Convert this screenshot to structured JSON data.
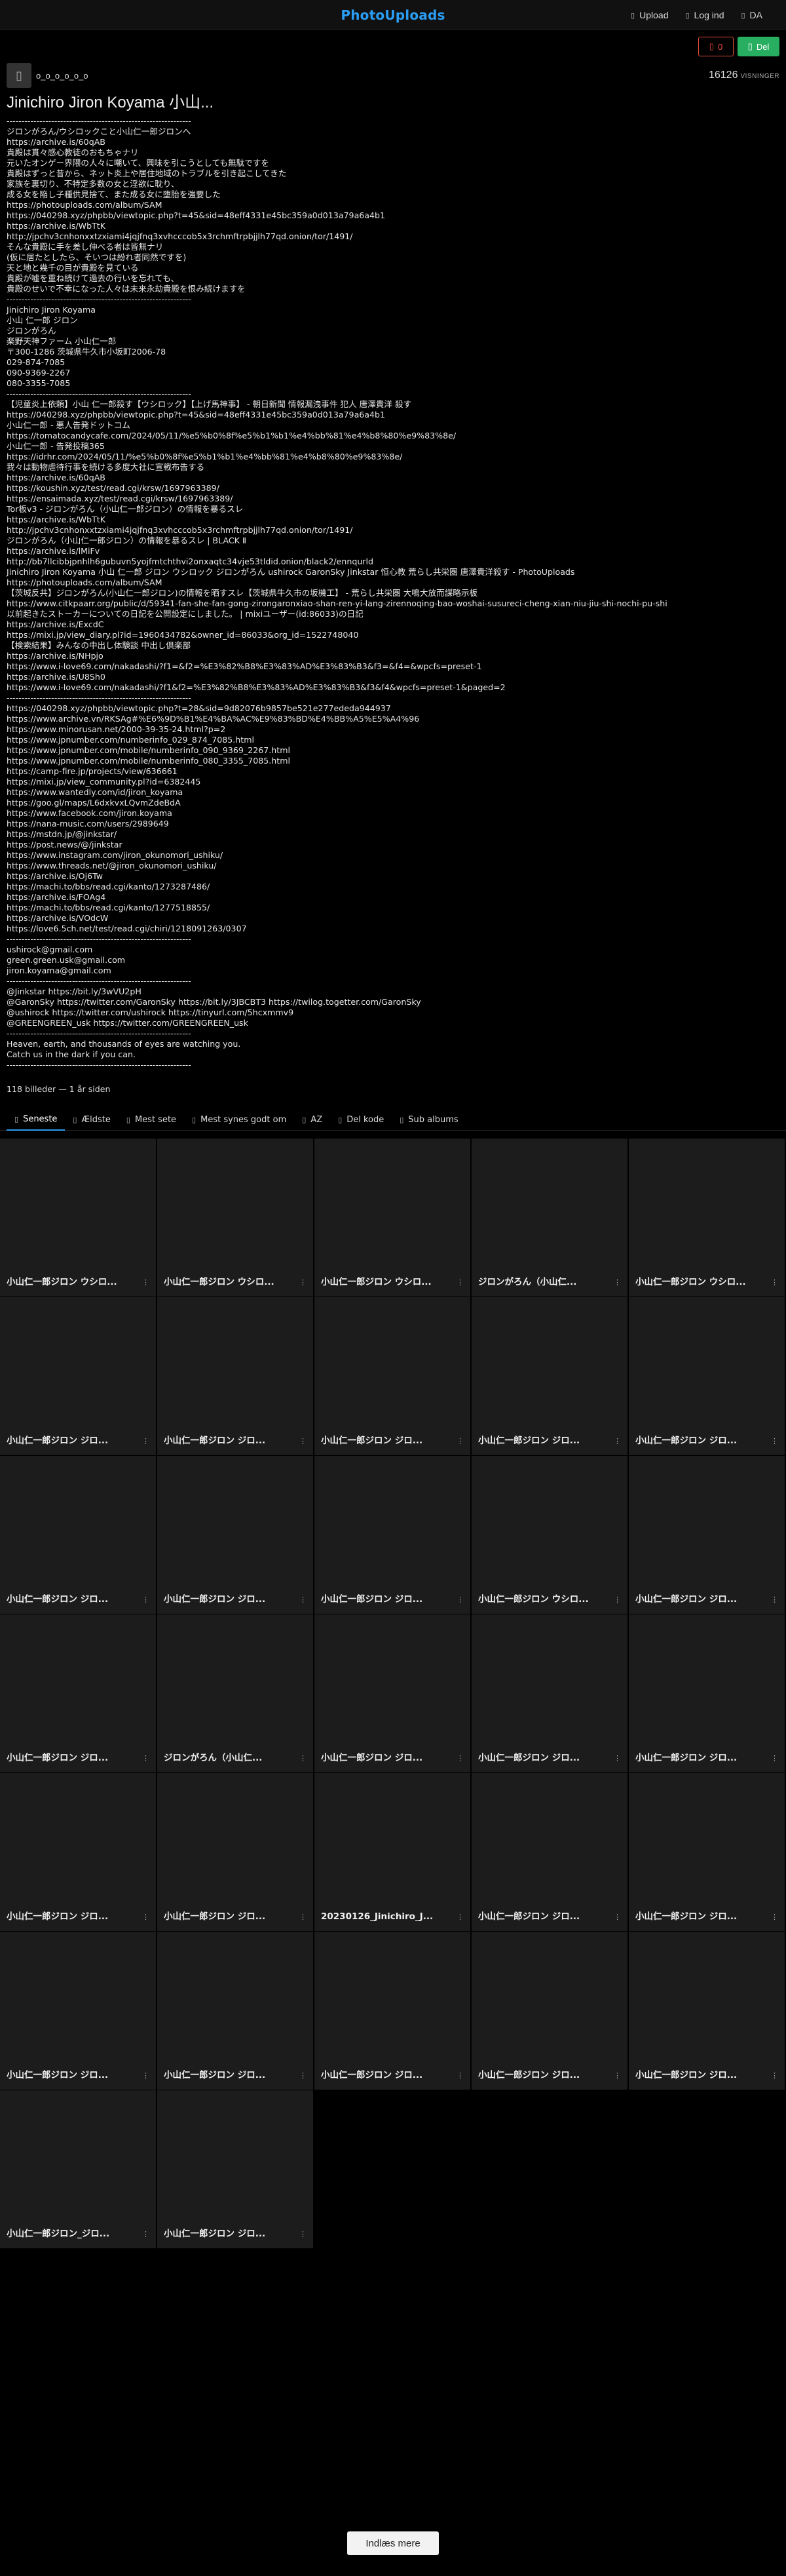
{
  "header": {
    "brand": "PhotoUploads",
    "upload": "Upload",
    "login": "Log ind",
    "lang": "DA"
  },
  "actions": {
    "like_count": "0",
    "share_label": "Del"
  },
  "owner": {
    "name": "o_o_o_o_o_o",
    "views": "16126",
    "views_label": "VISNINGER"
  },
  "album": {
    "title": "Jinichiro Jiron Koyama 小山...",
    "description": "--------------------------------------------------------------\nジロンがろん/ウシロックこと小山仁一郎ジロンへ\nhttps://archive.is/60qAB\n貴殿は貫々感心教徒のおもちゃナリ\n元いたオンゲー界隈の人々に嘲いて、興味を引こうとしても無駄ですを\n貴殿はずっと昔から、ネット炎上や居住地域のトラブルを引き起こしてきた\n家族を裏切り、不特定多数の女と淫欲に耽り、\n成る女を陥し子種供見捨て、また成る女に堕胎を強要した\nhttps://photouploads.com/album/SAM\nhttps://040298.xyz/phpbb/viewtopic.php?t=45&sid=48eff4331e45bc359a0d013a79a6a4b1\nhttps://archive.is/WbTtK\nhttp://jpchv3cnhonxxtzxiami4jqjfnq3xvhcccob5x3rchmftrpbjjlh77qd.onion/tor/1491/\nそんな貴殿に手を差し伸べる者は皆無ナリ\n(仮に居たとしたら、そいつは紛れ者同然ですを)\n天と地と幾千の目が貴殿を見ている\n貴殿が嘘を重ね続けて過去の行いを忘れても、\n貴殿のせいで不幸になった人々は未来永劫貴殿を恨み続けますを\n--------------------------------------------------------------\nJinichiro Jiron Koyama\n小山 仁一郎 ジロン\nジロンがろん\n楽野天神ファーム 小山仁一郎\n〒300-1286 茨城県牛久市小坂町2006-78\n029-874-7085\n090-9369-2267\n080-3355-7085\n--------------------------------------------------------------\n【児童炎上依頼】小山 仁一郎殺す【ウシロック】【上げ馬神事】 - 朝日新聞 情報漏洩事件 犯人 唐澤貴洋 殺す\nhttps://040298.xyz/phpbb/viewtopic.php?t=45&sid=48eff4331e45bc359a0d013a79a6a4b1\n小山仁一郎 - 悪人告発ドットコム\nhttps://tomatocandycafe.com/2024/05/11/%e5%b0%8f%e5%b1%b1%e4%bb%81%e4%b8%80%e9%83%8e/\n小山仁一郎 - 告発投稿365\nhttps://idrhr.com/2024/05/11/%e5%b0%8f%e5%b1%b1%e4%bb%81%e4%b8%80%e9%83%8e/\n我々は動物虐待行事を続ける多度大社に宣戦布告する\nhttps://archive.is/60qAB\nhttps://koushin.xyz/test/read.cgi/krsw/1697963389/\nhttps://ensaimada.xyz/test/read.cgi/krsw/1697963389/\nTor板v3 - ジロンがろん（小山仁一郎ジロン）の情報を暴るスレ\nhttps://archive.is/WbTtK\nhttp://jpchv3cnhonxxtzxiami4jqjfnq3xvhcccob5x3rchmftrpbjjlh77qd.onion/tor/1491/\nジロンがろん（小山仁一郎ジロン）の情報を暴るスレ | BLACK Ⅱ\nhttps://archive.is/lMiFv\nhttp://bb7llcibbjpnhlh6gubuvn5yojfmtchthvi2onxaqtc34vje53tldid.onion/black2/ennqurld\nJinichiro Jiron Koyama 小山 仁一郎 ジロン ウシロック ジロンがろん ushirock GaronSky Jinkstar 恒心教 荒らし共栄圏 唐澤貴洋殺す - PhotoUploads\nhttps://photouploads.com/album/SAM\n【茨城反共】ジロンがろん(小山仁一郎ジロン)の情報を晒すスレ【茨城県牛久市の坂機工】 - 荒らし共栄圏 大鳴大放而謀略示板\nhttps://www.citkpaarr.org/public/d/59341-fan-she-fan-gong-zirongaronxiao-shan-ren-yi-lang-zirennoqing-bao-woshai-susureci-cheng-xian-niu-jiu-shi-nochi-pu-shi\n以前起きたストーカーについての日記を公開設定にしました。 | mixiユーザー(id:86033)の日記\nhttps://archive.is/ExcdC\nhttps://mixi.jp/view_diary.pl?id=1960434782&owner_id=86033&org_id=1522748040\n【検索結果】みんなの中出し体験談 中出し倶楽部\nhttps://archive.is/NHpjo\nhttps://www.i-love69.com/nakadashi/?f1=&f2=%E3%82%B8%E3%83%AD%E3%83%B3&f3=&f4=&wpcfs=preset-1\nhttps://archive.is/U8Sh0\nhttps://www.i-love69.com/nakadashi/?f1&f2=%E3%82%B8%E3%83%AD%E3%83%B3&f3&f4&wpcfs=preset-1&paged=2\n--------------------------------------------------------------\nhttps://040298.xyz/phpbb/viewtopic.php?t=28&sid=9d82076b9857be521e277ededa944937\nhttps://www.archive.vn/RKSAg#%E6%9D%B1%E4%BA%AC%E9%83%BD%E4%BB%A5%E5%A4%96\nhttps://www.minorusan.net/2000-39-35-24.html?p=2\nhttps://www.jpnumber.com/numberinfo_029_874_7085.html\nhttps://www.jpnumber.com/mobile/numberinfo_090_9369_2267.html\nhttps://www.jpnumber.com/mobile/numberinfo_080_3355_7085.html\nhttps://camp-fire.jp/projects/view/636661\nhttps://mixi.jp/view_community.pl?id=6382445\nhttps://www.wantedly.com/id/jiron_koyama\nhttps://goo.gl/maps/L6dxkvxLQvmZdeBdA\nhttps://www.facebook.com/jiron.koyama\nhttps://nana-music.com/users/2989649\nhttps://mstdn.jp/@jinkstar/\nhttps://post.news/@/jinkstar\nhttps://www.instagram.com/jiron_okunomori_ushiku/\nhttps://www.threads.net/@jiron_okunomori_ushiku/\nhttps://archive.is/Oj6Tw\nhttps://machi.to/bbs/read.cgi/kanto/1273287486/\nhttps://archive.is/FOAg4\nhttps://machi.to/bbs/read.cgi/kanto/1277518855/\nhttps://archive.is/VOdcW\nhttps://love6.5ch.net/test/read.cgi/chiri/1218091263/0307\n--------------------------------------------------------------\nushirock@gmail.com\ngreen.green.usk@gmail.com\njiron.koyama@gmail.com\n--------------------------------------------------------------\n@Jinkstar https://bit.ly/3wVU2pH\n@GaronSky https://twitter.com/GaronSky https://bit.ly/3JBCBT3 https://twilog.togetter.com/GaronSky\n@ushirock https://twitter.com/ushirock https://tinyurl.com/5hcxmmv9\n@GREENGREEN_usk https://twitter.com/GREENGREEN_usk\n--------------------------------------------------------------\nHeaven, earth, and thousands of eyes are watching you.\nCatch us in the dark if you can.\n--------------------------------------------------------------",
    "meta": "118 billeder — 1 år siden"
  },
  "tabs": [
    {
      "label": "Seneste",
      "active": true
    },
    {
      "label": "Ældste"
    },
    {
      "label": "Mest sete"
    },
    {
      "label": "Mest synes godt om"
    },
    {
      "label": "AZ"
    },
    {
      "label": "Del kode"
    },
    {
      "label": "Sub albums"
    }
  ],
  "images": [
    "小山仁一郎ジロン ウシロ...",
    "小山仁一郎ジロン ウシロ...",
    "小山仁一郎ジロン ウシロ...",
    "ジロンがろん（小山仁...",
    "小山仁一郎ジロン ウシロ...",
    "小山仁一郎ジロン ジロ...",
    "小山仁一郎ジロン ジロ...",
    "小山仁一郎ジロン ジロ...",
    "小山仁一郎ジロン ジロ...",
    "小山仁一郎ジロン ジロ...",
    "小山仁一郎ジロン ジロ...",
    "小山仁一郎ジロン ジロ...",
    "小山仁一郎ジロン ジロ...",
    "小山仁一郎ジロン ウシロ...",
    "小山仁一郎ジロン ジロ...",
    "小山仁一郎ジロン ジロ...",
    "ジロンがろん（小山仁...",
    "小山仁一郎ジロン ジロ...",
    "小山仁一郎ジロン ジロ...",
    "小山仁一郎ジロン ジロ...",
    "小山仁一郎ジロン ジロ...",
    "小山仁一郎ジロン ジロ...",
    "20230126_Jinichiro_J...",
    "小山仁一郎ジロン ジロ...",
    "小山仁一郎ジロン ジロ...",
    "小山仁一郎ジロン ジロ...",
    "小山仁一郎ジロン ジロ...",
    "小山仁一郎ジロン ジロ...",
    "小山仁一郎ジロン ジロ...",
    "小山仁一郎ジロン ジロ...",
    "小山仁一郎ジロン_ジロ...",
    "小山仁一郎ジロン ジロ..."
  ],
  "load_more": "Indlæs mere",
  "icons": {
    "upload": "upload-icon",
    "login": "user-icon",
    "lang": "globe-icon",
    "like": "heart-icon",
    "share": "share-icon",
    "item_menu": "dots-icon"
  }
}
